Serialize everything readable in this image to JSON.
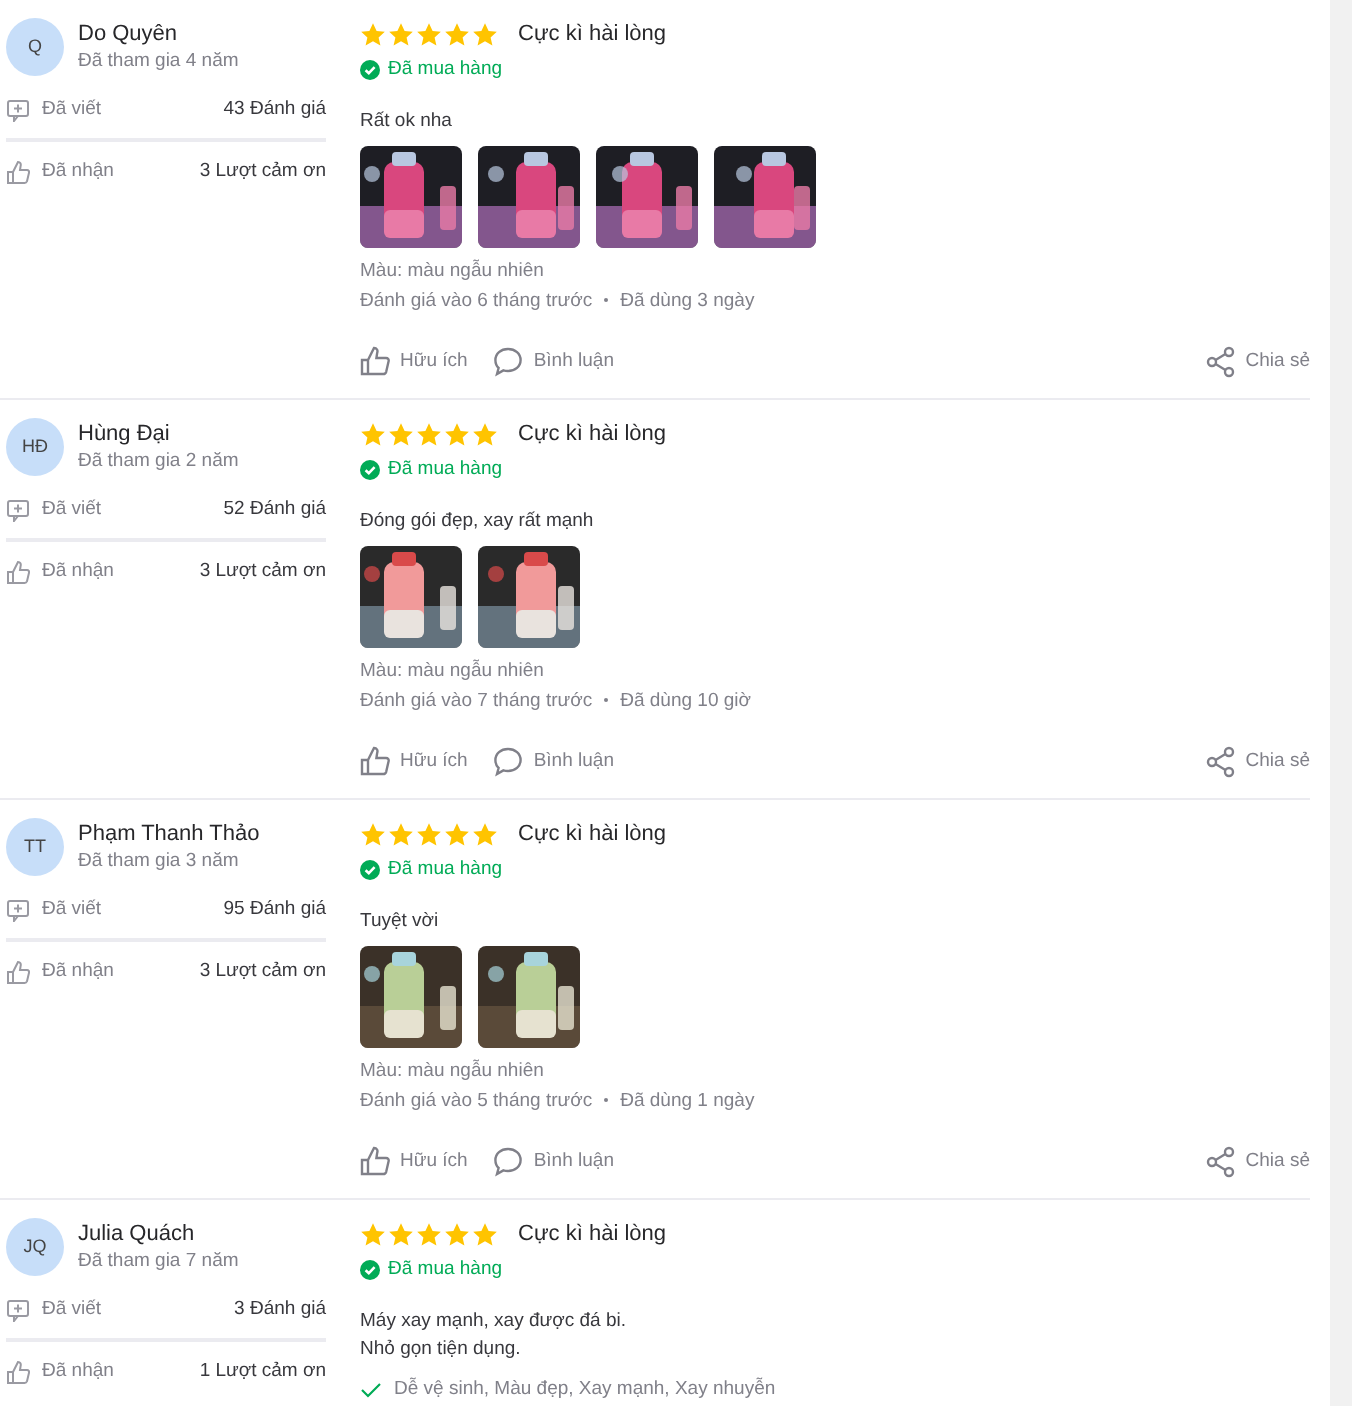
{
  "reviews": [
    {
      "avatar": "Q",
      "name": "Do Quyên",
      "joined": "Đã tham gia 4 năm",
      "written_label": "Đã viết",
      "written": "43 Đánh giá",
      "received_label": "Đã nhận",
      "received": "3 Lượt cảm ơn",
      "stars": 5,
      "rating_text": "Cực kì hài lòng",
      "verified": "Đã mua hàng",
      "comment": "Rất ok nha",
      "photos": [
        {
          "kind": "picture"
        },
        {
          "kind": "picture"
        },
        {
          "kind": "picture"
        },
        {
          "kind": "picture"
        }
      ],
      "variant": "Màu: màu ngẫu nhiên",
      "date": "Đánh giá vào 6 tháng trước",
      "used": "Đã dùng 3 ngày",
      "like": "Hữu ích",
      "reply": "Bình luận",
      "share": "Chia sẻ"
    },
    {
      "avatar": "HĐ",
      "name": "Hùng Đại",
      "joined": "Đã tham gia 2 năm",
      "written_label": "Đã viết",
      "written": "52 Đánh giá",
      "received_label": "Đã nhận",
      "received": "3 Lượt cảm ơn",
      "stars": 5,
      "rating_text": "Cực kì hài lòng",
      "verified": "Đã mua hàng",
      "comment": "Đóng gói đẹp, xay rất mạnh",
      "photos": [
        {
          "kind": "picture"
        },
        {
          "kind": "picture"
        }
      ],
      "variant": "Màu: màu ngẫu nhiên",
      "date": "Đánh giá vào 7 tháng trước",
      "used": "Đã dùng 10 giờ",
      "like": "Hữu ích",
      "reply": "Bình luận",
      "share": "Chia sẻ"
    },
    {
      "avatar": "TT",
      "name": "Phạm Thanh Thảo",
      "joined": "Đã tham gia 3 năm",
      "written_label": "Đã viết",
      "written": "95 Đánh giá",
      "received_label": "Đã nhận",
      "received": "3 Lượt cảm ơn",
      "stars": 5,
      "rating_text": "Cực kì hài lòng",
      "verified": "Đã mua hàng",
      "comment": "Tuyệt vời",
      "photos": [
        {
          "kind": "picture"
        },
        {
          "kind": "picture"
        }
      ],
      "variant": "Màu: màu ngẫu nhiên",
      "date": "Đánh giá vào 5 tháng trước",
      "used": "Đã dùng 1 ngày",
      "like": "Hữu ích",
      "reply": "Bình luận",
      "share": "Chia sẻ"
    },
    {
      "avatar": "JQ",
      "name": "Julia Quách",
      "joined": "Đã tham gia 7 năm",
      "written_label": "Đã viết",
      "written": "3 Đánh giá",
      "received_label": "Đã nhận",
      "received": "1 Lượt cảm ơn",
      "stars": 5,
      "rating_text": "Cực kì hài lòng",
      "verified": "Đã mua hàng",
      "comment_lines": [
        "Máy xay mạnh, xay được đá bi.",
        "Nhỏ gọn tiện dụng."
      ],
      "tags": "Dễ vệ sinh, Màu đẹp, Xay mạnh, Xay nhuyễn"
    }
  ]
}
